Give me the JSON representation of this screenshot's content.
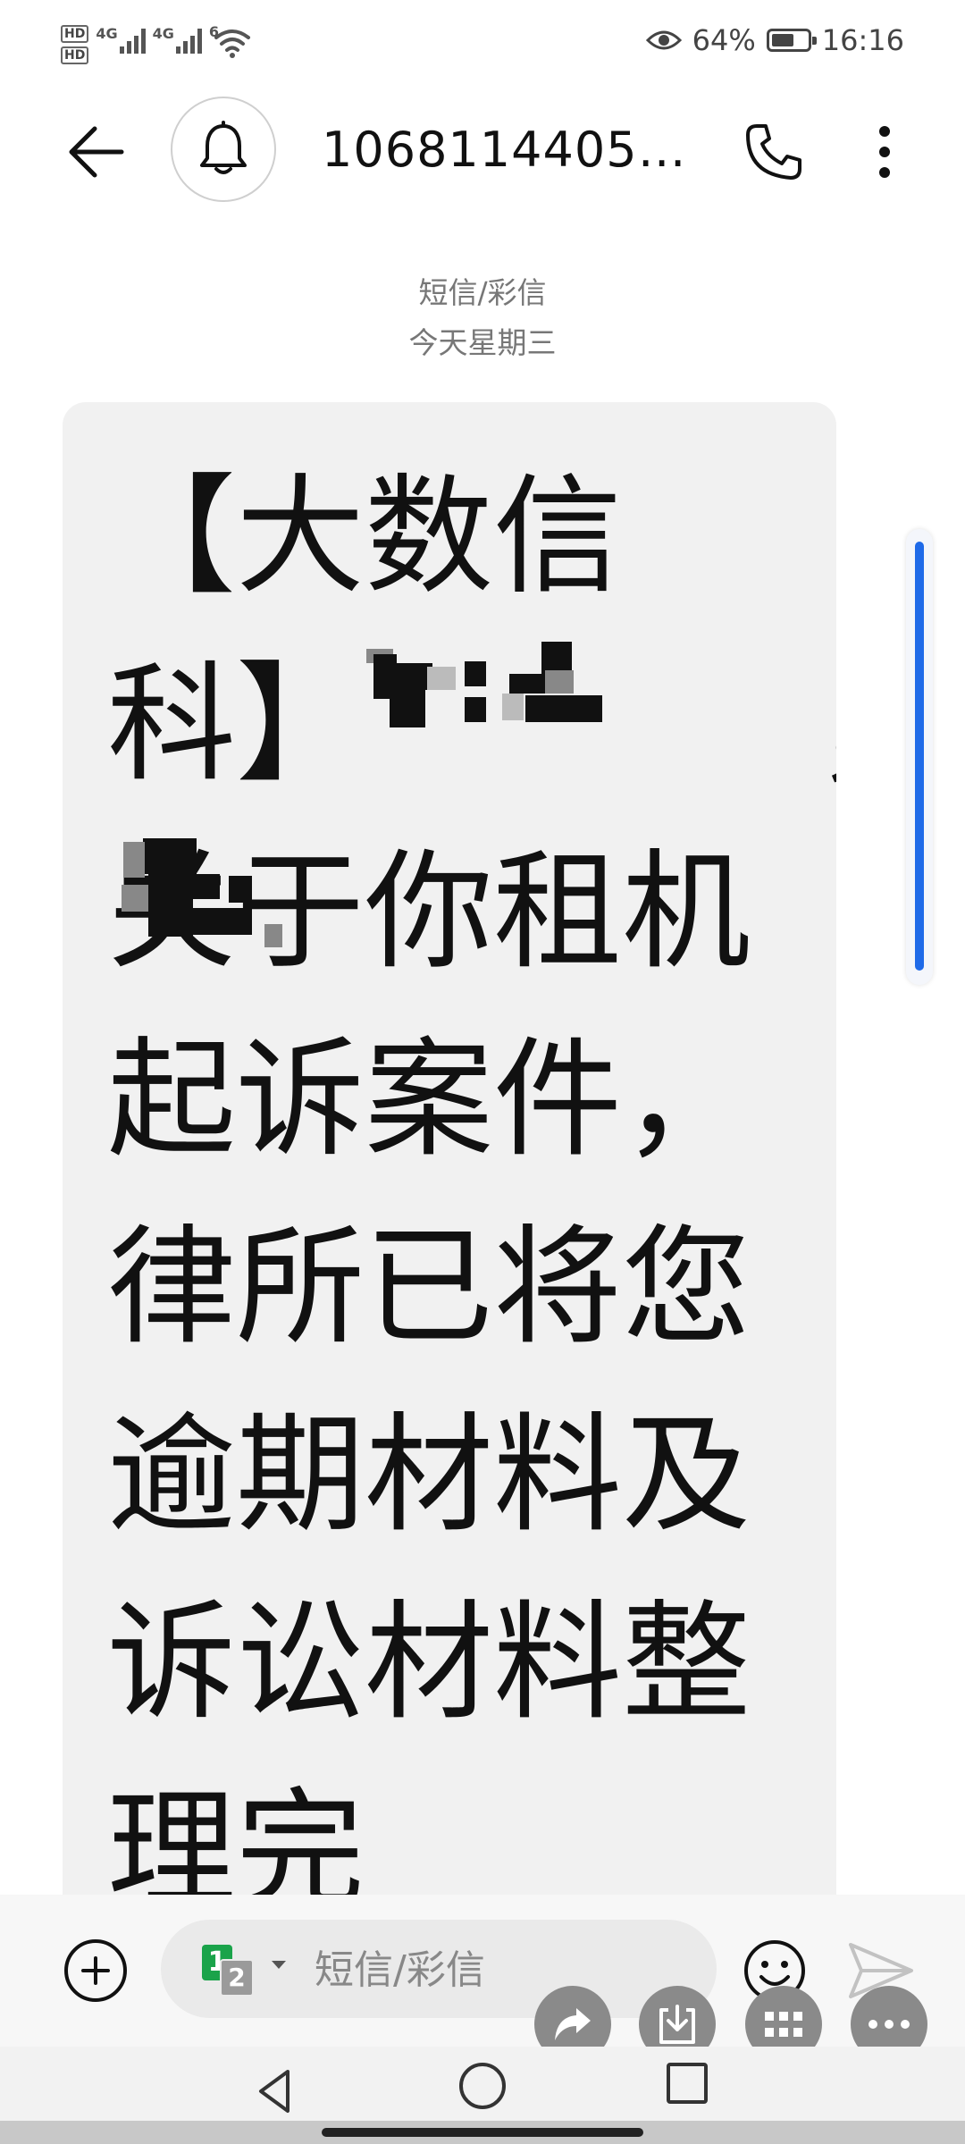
{
  "status_bar": {
    "hd_1": "HD",
    "hd_2": "HD",
    "net_1": "4G",
    "net_2": "4G",
    "wifi_label": "6",
    "battery_level": 0.64,
    "battery_text": "64%",
    "time": "16:16"
  },
  "header": {
    "title": "10681144050..."
  },
  "meta": {
    "channel": "短信/彩信",
    "date": "今天星期三"
  },
  "message": {
    "text": "【大数信科】           ，关于你租机起诉案件，律所已将您逾期材料及诉讼材料整理完"
  },
  "composer": {
    "sim_primary": "1",
    "sim_secondary": "2",
    "placeholder": "短信/彩信"
  },
  "colors": {
    "accent": "#1f6ae8",
    "bubble": "#f1f1f1",
    "sim_green": "#1aa34a"
  }
}
